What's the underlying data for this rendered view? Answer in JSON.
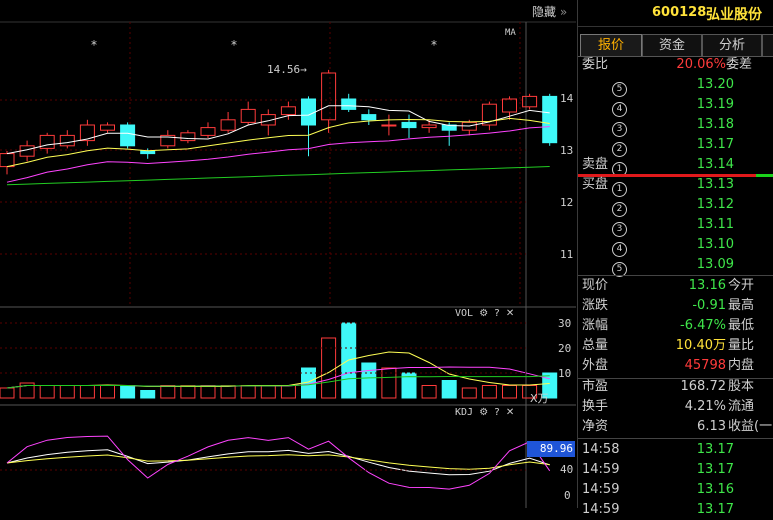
{
  "chart": {
    "hide_label": "隐藏",
    "ma_label": "MA",
    "high_marker": "14.56",
    "price_axis": [
      "14",
      "13",
      "12",
      "11"
    ],
    "star": "*",
    "vol_label": "VOL",
    "vol_axis": [
      "30",
      "20",
      "10"
    ],
    "vol_unit": "X万",
    "kdj_label": "KDJ",
    "kdj_current": "89.96",
    "kdj_axis": [
      "40",
      "0"
    ],
    "help_label": "?",
    "close_label": "✕"
  },
  "candles": [
    {
      "o": 12.7,
      "c": 12.95,
      "h": 13.0,
      "l": 12.55
    },
    {
      "o": 12.9,
      "c": 13.1,
      "h": 13.2,
      "l": 12.8
    },
    {
      "o": 13.05,
      "c": 13.3,
      "h": 13.35,
      "l": 12.95
    },
    {
      "o": 13.1,
      "c": 13.3,
      "h": 13.4,
      "l": 13.05
    },
    {
      "o": 13.2,
      "c": 13.5,
      "h": 13.6,
      "l": 13.1
    },
    {
      "o": 13.4,
      "c": 13.5,
      "h": 13.55,
      "l": 13.35
    },
    {
      "o": 13.5,
      "c": 13.1,
      "h": 13.55,
      "l": 13.05
    },
    {
      "o": 13.0,
      "c": 12.95,
      "h": 13.05,
      "l": 12.85
    },
    {
      "o": 13.1,
      "c": 13.3,
      "h": 13.4,
      "l": 13.05
    },
    {
      "o": 13.2,
      "c": 13.35,
      "h": 13.4,
      "l": 13.15
    },
    {
      "o": 13.3,
      "c": 13.45,
      "h": 13.55,
      "l": 13.25
    },
    {
      "o": 13.4,
      "c": 13.6,
      "h": 13.75,
      "l": 13.35
    },
    {
      "o": 13.55,
      "c": 13.8,
      "h": 13.95,
      "l": 13.5
    },
    {
      "o": 13.5,
      "c": 13.7,
      "h": 13.8,
      "l": 13.3
    },
    {
      "o": 13.7,
      "c": 13.85,
      "h": 13.95,
      "l": 13.6
    },
    {
      "o": 14.0,
      "c": 13.5,
      "h": 14.05,
      "l": 12.9
    },
    {
      "o": 13.6,
      "c": 14.5,
      "h": 14.56,
      "l": 13.35
    },
    {
      "o": 14.0,
      "c": 13.8,
      "h": 14.1,
      "l": 13.75
    },
    {
      "o": 13.7,
      "c": 13.6,
      "h": 13.8,
      "l": 13.5
    },
    {
      "o": 13.5,
      "c": 13.5,
      "h": 13.7,
      "l": 13.3
    },
    {
      "o": 13.55,
      "c": 13.45,
      "h": 13.7,
      "l": 13.25
    },
    {
      "o": 13.45,
      "c": 13.5,
      "h": 13.6,
      "l": 13.35
    },
    {
      "o": 13.5,
      "c": 13.4,
      "h": 13.55,
      "l": 13.1
    },
    {
      "o": 13.4,
      "c": 13.55,
      "h": 13.6,
      "l": 13.3
    },
    {
      "o": 13.5,
      "c": 13.9,
      "h": 13.95,
      "l": 13.4
    },
    {
      "o": 13.75,
      "c": 14.0,
      "h": 14.05,
      "l": 13.6
    },
    {
      "o": 13.85,
      "c": 14.05,
      "h": 14.1,
      "l": 13.8
    },
    {
      "o": 14.05,
      "c": 13.16,
      "h": 14.1,
      "l": 13.1
    }
  ],
  "volumes": [
    4,
    6,
    5,
    5,
    5,
    5,
    5,
    3,
    5,
    5,
    5,
    5,
    5,
    5,
    5,
    12,
    24,
    30,
    14,
    12,
    10,
    5,
    7,
    4,
    5,
    5,
    5,
    10
  ],
  "quote": {
    "code": "600128",
    "name": "弘业股份",
    "tabs": [
      "报价",
      "资金",
      "分析"
    ],
    "weibi_label": "委比",
    "weibi_value": "20.06%",
    "weicha_label": "委差",
    "sell_label": "卖盘",
    "buy_label": "买盘",
    "sell": [
      {
        "n": "5",
        "p": "13.20"
      },
      {
        "n": "4",
        "p": "13.19"
      },
      {
        "n": "3",
        "p": "13.18"
      },
      {
        "n": "2",
        "p": "13.17"
      },
      {
        "n": "1",
        "p": "13.14"
      }
    ],
    "buy": [
      {
        "n": "1",
        "p": "13.13"
      },
      {
        "n": "2",
        "p": "13.12"
      },
      {
        "n": "3",
        "p": "13.11"
      },
      {
        "n": "4",
        "p": "13.10"
      },
      {
        "n": "5",
        "p": "13.09"
      }
    ],
    "stats": [
      {
        "l": "现价",
        "v": "13.16",
        "r": "今开",
        "c": "green"
      },
      {
        "l": "涨跌",
        "v": "-0.91",
        "r": "最高",
        "c": "green"
      },
      {
        "l": "涨幅",
        "v": "-6.47%",
        "r": "最低",
        "c": "green"
      },
      {
        "l": "总量",
        "v": "10.40万",
        "r": "量比",
        "c": "yellow"
      },
      {
        "l": "外盘",
        "v": "45798",
        "r": "内盘",
        "c": "red"
      },
      {
        "l": "市盈",
        "v": "168.72",
        "r": "股本",
        "c": "plain"
      },
      {
        "l": "换手",
        "v": "4.21%",
        "r": "流通",
        "c": "plain"
      },
      {
        "l": "净资",
        "v": "6.13",
        "r": "收益(一",
        "c": "plain"
      }
    ],
    "ticks": [
      {
        "t": "14:58",
        "p": "13.17"
      },
      {
        "t": "14:59",
        "p": "13.17"
      },
      {
        "t": "14:59",
        "p": "13.16"
      },
      {
        "t": "14:59",
        "p": "13.17"
      }
    ]
  },
  "colors": {
    "up": "#ff3b3b",
    "down": "#3ff8f8",
    "ma5": "#ffffff",
    "ma10": "#ffff55",
    "ma20": "#ff44ff",
    "ma60": "#22cc22"
  }
}
